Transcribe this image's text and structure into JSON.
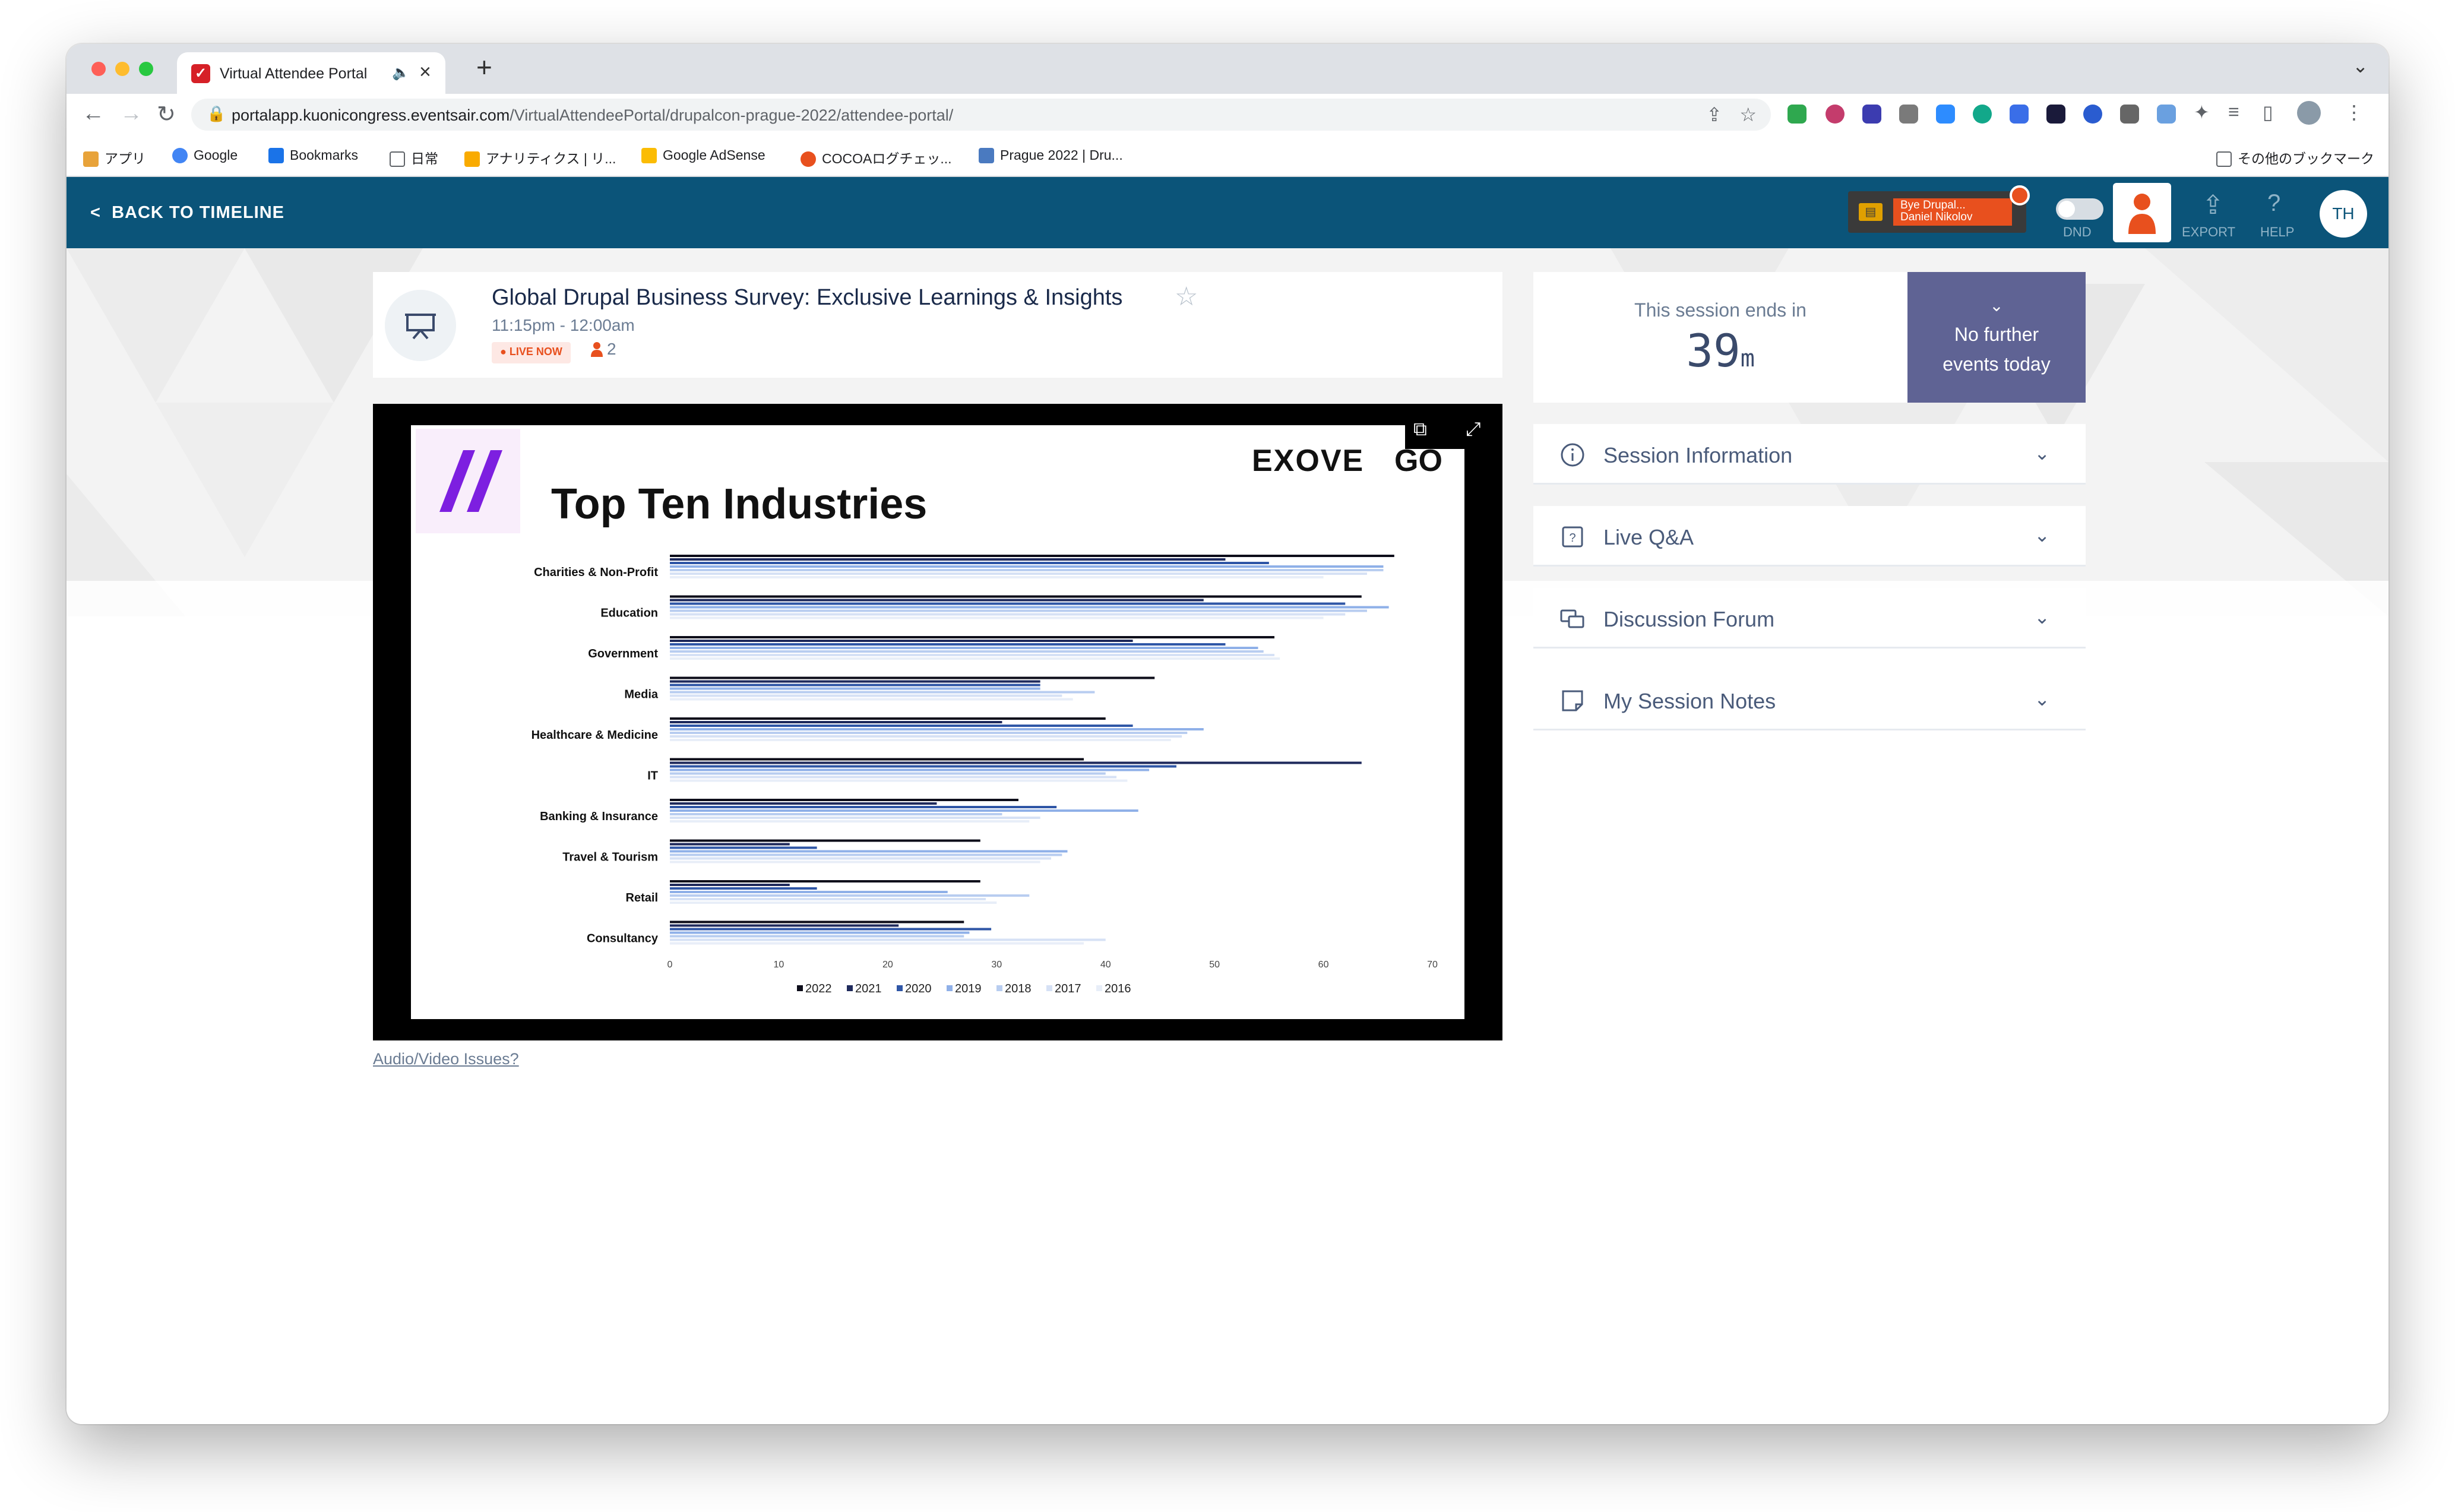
{
  "browser": {
    "tab_title": "Virtual Attendee Portal",
    "url_host": "portalapp.kuonicongress.eventsair.com",
    "url_path": "/VirtualAttendeePortal/drupalcon-prague-2022/attendee-portal/",
    "bookmarks": [
      "アプリ",
      "Google",
      "Bookmarks",
      "日常",
      "アナリティクス | リ...",
      "Google AdSense",
      "COCOAログチェッ...",
      "Prague 2022 | Dru..."
    ],
    "other_bookmarks": "その他のブックマーク"
  },
  "header": {
    "back_label": "BACK TO TIMELINE",
    "badge_line1": "Bye Drupal...",
    "badge_line2": "Daniel Nikolov",
    "dnd_label": "DND",
    "export_label": "EXPORT",
    "help_label": "HELP",
    "user_initials": "TH"
  },
  "session": {
    "title": "Global Drupal Business Survey: Exclusive Learnings & Insights",
    "time": "11:15pm - 12:00am",
    "live_label": "LIVE NOW",
    "attendees": "2"
  },
  "timer": {
    "label": "This session ends in",
    "value": "39",
    "unit": "m",
    "next_text_1": "No further",
    "next_text_2": "events today"
  },
  "accordion": [
    "Session Information",
    "Live Q&A",
    "Discussion Forum",
    "My Session Notes"
  ],
  "av_issues": "Audio/Video Issues?",
  "slide": {
    "brand": "EXOVE",
    "brand2": "GO",
    "title": "Top Ten Industries"
  },
  "chart_data": {
    "type": "bar",
    "orientation": "horizontal",
    "title": "Top Ten Industries",
    "categories": [
      "Charities & Non-Profit",
      "Education",
      "Government",
      "Media",
      "Healthcare & Medicine",
      "IT",
      "Banking & Insurance",
      "Travel & Tourism",
      "Retail",
      "Consultancy"
    ],
    "xlim": [
      0,
      70
    ],
    "xticks": [
      0,
      10,
      20,
      30,
      40,
      50,
      60,
      70
    ],
    "legend_position": "bottom",
    "series": [
      {
        "name": "2022",
        "color": "#0d0d1a",
        "values": [
          66.5,
          63.5,
          55.5,
          44.5,
          40,
          38,
          32,
          28.5,
          28.5,
          27
        ]
      },
      {
        "name": "2021",
        "color": "#1f2a5c",
        "values": [
          51,
          49,
          42.5,
          34,
          30.5,
          63.5,
          24.5,
          11,
          11,
          21
        ]
      },
      {
        "name": "2020",
        "color": "#2f56a6",
        "values": [
          55,
          62,
          51,
          34,
          42.5,
          46.5,
          35.5,
          13.5,
          13.5,
          29.5
        ]
      },
      {
        "name": "2019",
        "color": "#8fb0e8",
        "values": [
          65.5,
          66,
          54,
          34,
          49,
          44,
          43,
          36.5,
          25.5,
          27.5
        ]
      },
      {
        "name": "2018",
        "color": "#b8cdf0",
        "values": [
          65.5,
          64,
          54.5,
          39,
          47.5,
          40,
          30.5,
          36,
          33,
          27
        ]
      },
      {
        "name": "2017",
        "color": "#d6e1f5",
        "values": [
          64,
          62,
          55.5,
          36,
          47,
          41,
          34,
          35,
          29,
          40
        ]
      },
      {
        "name": "2016",
        "color": "#e8eef8",
        "values": [
          60,
          60,
          56,
          37,
          46,
          42,
          33,
          34,
          30,
          38
        ]
      }
    ]
  }
}
